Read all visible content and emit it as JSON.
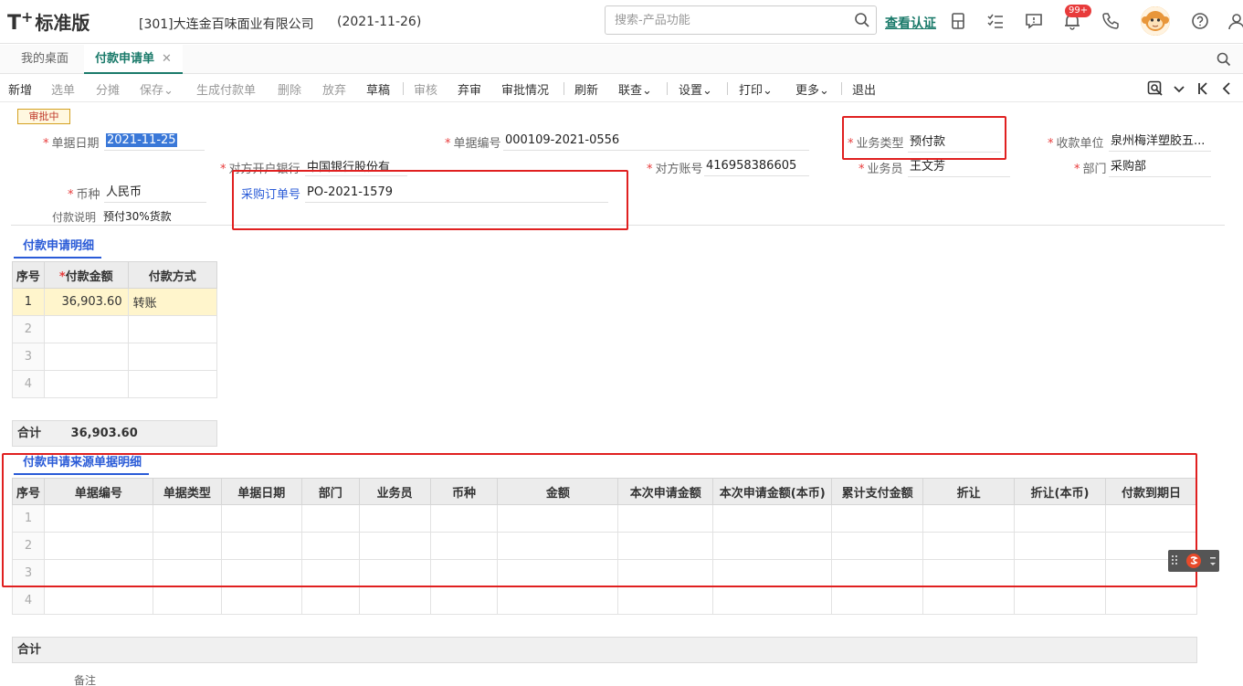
{
  "header": {
    "logo_main": "T",
    "logo_sup": "+",
    "logo_edition": "标准版",
    "company": "[301]大连金百味面业有限公司",
    "date": "(2021-11-26)",
    "search_placeholder": "搜索-产品功能",
    "verify_link": "查看认证",
    "notification_count": "99+"
  },
  "tabs": {
    "desktop": "我的桌面",
    "active": "付款申请单",
    "close": "✕"
  },
  "toolbar": {
    "add": "新增",
    "select": "选单",
    "split": "分摊",
    "save": "保存",
    "gen_payment": "生成付款单",
    "delete": "删除",
    "discard": "放弃",
    "draft": "草稿",
    "audit": "审核",
    "unaudit": "弃审",
    "approval_status": "审批情况",
    "refresh": "刷新",
    "link_query": "联查",
    "settings": "设置",
    "print": "打印",
    "more": "更多",
    "exit": "退出",
    "caret": "⌄"
  },
  "form": {
    "status": "审批中",
    "doc_date_label": "单据日期",
    "doc_date": "2021-11-25",
    "doc_no_label": "单据编号",
    "doc_no": "000109-2021-0556",
    "biz_type_label": "业务类型",
    "biz_type": "预付款",
    "payee_label": "收款单位",
    "payee": "泉州梅洋塑胶五...",
    "bank_label": "对方开户银行",
    "bank": "中国银行股份有",
    "account_label": "对方账号",
    "account": "416958386605",
    "salesman_label": "业务员",
    "salesman": "王文芳",
    "dept_label": "部门",
    "dept": "采购部",
    "currency_label": "币种",
    "currency": "人民币",
    "po_label": "采购订单号",
    "po": "PO-2021-1579",
    "remark_label": "付款说明",
    "remark": "预付30%货款",
    "required_mark": "*"
  },
  "detail": {
    "title": "付款申请明细",
    "columns": [
      "序号",
      "付款金额",
      "付款方式"
    ],
    "rows": [
      {
        "idx": "1",
        "amount": "36,903.60",
        "method": "转账"
      },
      {
        "idx": "2",
        "amount": "",
        "method": ""
      },
      {
        "idx": "3",
        "amount": "",
        "method": ""
      },
      {
        "idx": "4",
        "amount": "",
        "method": ""
      }
    ],
    "total_label": "合计",
    "total_value": "36,903.60"
  },
  "source": {
    "title": "付款申请来源单据明细",
    "columns": [
      "序号",
      "单据编号",
      "单据类型",
      "单据日期",
      "部门",
      "业务员",
      "币种",
      "金额",
      "本次申请金额",
      "本次申请金额(本币)",
      "累计支付金额",
      "折让",
      "折让(本币)",
      "付款到期日"
    ],
    "row_indices": [
      "1",
      "2",
      "3",
      "4"
    ],
    "total_label": "合计",
    "note_label": "备注"
  }
}
